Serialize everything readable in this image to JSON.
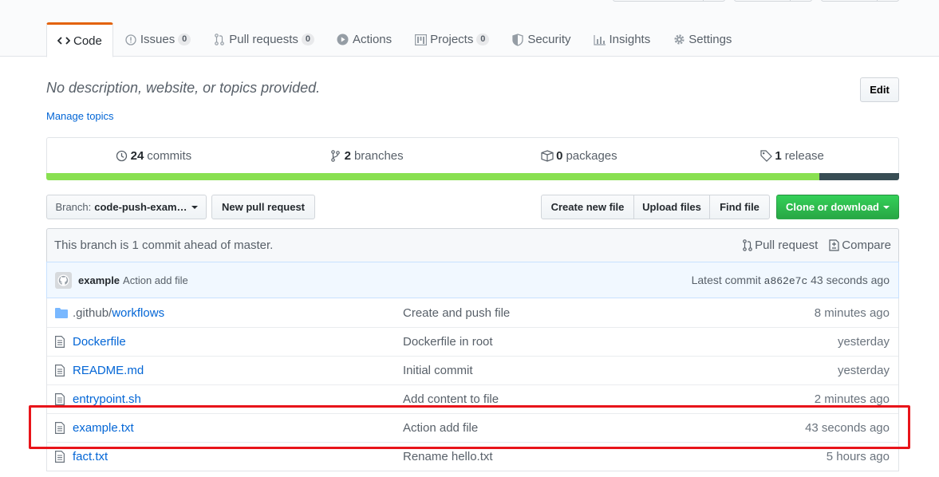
{
  "tabs": [
    {
      "label": "Code",
      "icon": "code-icon",
      "counter": null,
      "selected": true
    },
    {
      "label": "Issues",
      "icon": "issue-opened-icon",
      "counter": "0",
      "selected": false
    },
    {
      "label": "Pull requests",
      "icon": "git-pull-request-icon",
      "counter": "0",
      "selected": false
    },
    {
      "label": "Actions",
      "icon": "play-icon",
      "counter": null,
      "selected": false
    },
    {
      "label": "Projects",
      "icon": "project-icon",
      "counter": "0",
      "selected": false
    },
    {
      "label": "Security",
      "icon": "shield-icon",
      "counter": null,
      "selected": false
    },
    {
      "label": "Insights",
      "icon": "graph-icon",
      "counter": null,
      "selected": false
    },
    {
      "label": "Settings",
      "icon": "gear-icon",
      "counter": null,
      "selected": false
    }
  ],
  "repo": {
    "description": "No description, website, or topics provided.",
    "manage_topics": "Manage topics",
    "edit_label": "Edit"
  },
  "summary": {
    "commits_count": "24",
    "commits_label": "commits",
    "branches_count": "2",
    "branches_label": "branches",
    "packages_count": "0",
    "packages_label": "packages",
    "releases_count": "1",
    "releases_label": "release"
  },
  "language_bar": [
    {
      "color": "#89e051",
      "percent": 90.6
    },
    {
      "color": "#384d54",
      "percent": 9.4
    }
  ],
  "file_nav": {
    "branch_prefix": "Branch:",
    "branch_name": "code-push-exam…",
    "new_pull_request": "New pull request",
    "create_new_file": "Create new file",
    "upload_files": "Upload files",
    "find_file": "Find file",
    "clone_or_download": "Clone or download"
  },
  "branch_info": {
    "text": "This branch is 1 commit ahead of master.",
    "pull_request": "Pull request",
    "compare": "Compare"
  },
  "latest_commit": {
    "author": "example",
    "message": "Action add file",
    "label": "Latest commit",
    "sha": "a862e7c",
    "age": "43 seconds ago"
  },
  "files": [
    {
      "type": "dir",
      "prefix": ".github/",
      "name": "workflows",
      "message": "Create and push file",
      "age": "8 minutes ago"
    },
    {
      "type": "file",
      "prefix": "",
      "name": "Dockerfile",
      "message": "Dockerfile in root",
      "age": "yesterday"
    },
    {
      "type": "file",
      "prefix": "",
      "name": "README.md",
      "message": "Initial commit",
      "age": "yesterday"
    },
    {
      "type": "file",
      "prefix": "",
      "name": "entrypoint.sh",
      "message": "Add content to file",
      "age": "2 minutes ago"
    },
    {
      "type": "file",
      "prefix": "",
      "name": "example.txt",
      "message": "Action add file",
      "age": "43 seconds ago"
    },
    {
      "type": "file",
      "prefix": "",
      "name": "fact.txt",
      "message": "Rename hello.txt",
      "age": "5 hours ago"
    }
  ]
}
